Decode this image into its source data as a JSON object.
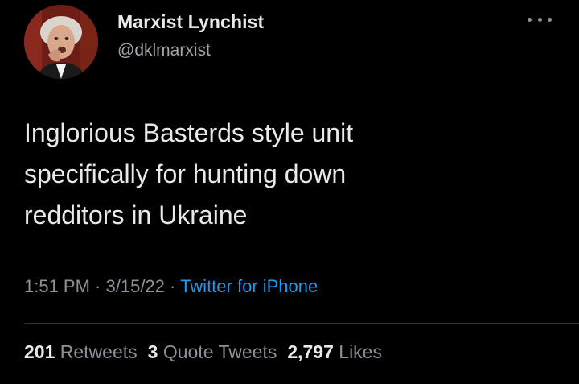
{
  "author": {
    "display_name": "Marxist Lynchist",
    "handle": "@dklmarxist"
  },
  "more_icon": "more-horizontal-icon",
  "tweet": {
    "lines": [
      "Inglorious Basterds style unit",
      "specifically for hunting down",
      "redditors in Ukraine"
    ]
  },
  "meta": {
    "time": "1:51 PM",
    "separator": " · ",
    "date": "3/15/22",
    "source": "Twitter for iPhone"
  },
  "stats": {
    "retweets_count": "201",
    "retweets_label": "Retweets",
    "quotes_count": "3",
    "quotes_label": "Quote Tweets",
    "likes_count": "2,797",
    "likes_label": "Likes"
  },
  "colors": {
    "background": "#000000",
    "text": "#e7e9ea",
    "secondary_text": "#8b9298",
    "link": "#1d9bf0",
    "divider": "#2f3336"
  }
}
